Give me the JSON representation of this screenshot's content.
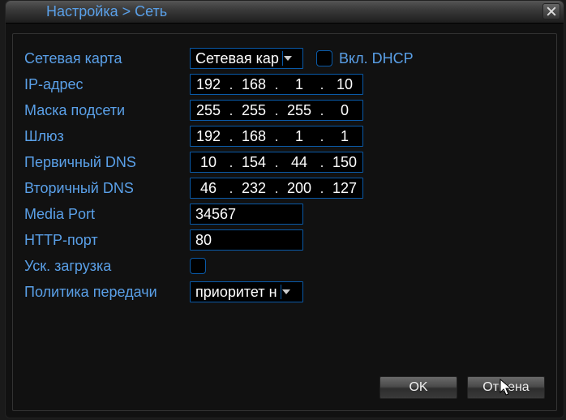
{
  "title": "Настройка > Сеть",
  "labels": {
    "nic": "Сетевая карта",
    "ip": "IP-адрес",
    "mask": "Маска подсети",
    "gateway": "Шлюз",
    "dns1": "Первичный DNS",
    "dns2": "Вторичный DNS",
    "media_port": "Media Port",
    "http_port": "HTTP-порт",
    "hs_download": "Уск. загрузка",
    "transfer_policy": "Политика передачи",
    "dhcp": "Вкл. DHCP"
  },
  "values": {
    "nic": "Сетевая кар",
    "dhcp_checked": false,
    "ip": [
      "192",
      "168",
      "1",
      "10"
    ],
    "mask": [
      "255",
      "255",
      "255",
      "0"
    ],
    "gateway": [
      "192",
      "168",
      "1",
      "1"
    ],
    "dns1": [
      "10",
      "154",
      "44",
      "150"
    ],
    "dns2": [
      "46",
      "232",
      "200",
      "127"
    ],
    "media_port": "34567",
    "http_port": "80",
    "hs_download_checked": false,
    "transfer_policy": "приоритет н"
  },
  "buttons": {
    "ok": "OK",
    "cancel": "Отмена"
  }
}
